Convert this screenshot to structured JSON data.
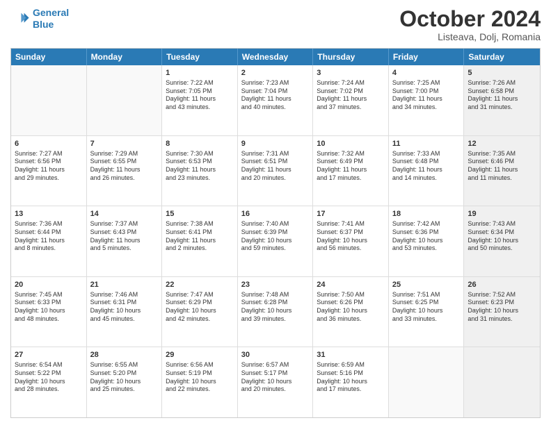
{
  "header": {
    "logo_line1": "General",
    "logo_line2": "Blue",
    "month": "October 2024",
    "location": "Listeava, Dolj, Romania"
  },
  "days_of_week": [
    "Sunday",
    "Monday",
    "Tuesday",
    "Wednesday",
    "Thursday",
    "Friday",
    "Saturday"
  ],
  "rows": [
    [
      {
        "day": "",
        "empty": true
      },
      {
        "day": "",
        "empty": true
      },
      {
        "day": "1",
        "line1": "Sunrise: 7:22 AM",
        "line2": "Sunset: 7:05 PM",
        "line3": "Daylight: 11 hours",
        "line4": "and 43 minutes."
      },
      {
        "day": "2",
        "line1": "Sunrise: 7:23 AM",
        "line2": "Sunset: 7:04 PM",
        "line3": "Daylight: 11 hours",
        "line4": "and 40 minutes."
      },
      {
        "day": "3",
        "line1": "Sunrise: 7:24 AM",
        "line2": "Sunset: 7:02 PM",
        "line3": "Daylight: 11 hours",
        "line4": "and 37 minutes."
      },
      {
        "day": "4",
        "line1": "Sunrise: 7:25 AM",
        "line2": "Sunset: 7:00 PM",
        "line3": "Daylight: 11 hours",
        "line4": "and 34 minutes."
      },
      {
        "day": "5",
        "line1": "Sunrise: 7:26 AM",
        "line2": "Sunset: 6:58 PM",
        "line3": "Daylight: 11 hours",
        "line4": "and 31 minutes.",
        "shaded": true
      }
    ],
    [
      {
        "day": "6",
        "line1": "Sunrise: 7:27 AM",
        "line2": "Sunset: 6:56 PM",
        "line3": "Daylight: 11 hours",
        "line4": "and 29 minutes."
      },
      {
        "day": "7",
        "line1": "Sunrise: 7:29 AM",
        "line2": "Sunset: 6:55 PM",
        "line3": "Daylight: 11 hours",
        "line4": "and 26 minutes."
      },
      {
        "day": "8",
        "line1": "Sunrise: 7:30 AM",
        "line2": "Sunset: 6:53 PM",
        "line3": "Daylight: 11 hours",
        "line4": "and 23 minutes."
      },
      {
        "day": "9",
        "line1": "Sunrise: 7:31 AM",
        "line2": "Sunset: 6:51 PM",
        "line3": "Daylight: 11 hours",
        "line4": "and 20 minutes."
      },
      {
        "day": "10",
        "line1": "Sunrise: 7:32 AM",
        "line2": "Sunset: 6:49 PM",
        "line3": "Daylight: 11 hours",
        "line4": "and 17 minutes."
      },
      {
        "day": "11",
        "line1": "Sunrise: 7:33 AM",
        "line2": "Sunset: 6:48 PM",
        "line3": "Daylight: 11 hours",
        "line4": "and 14 minutes."
      },
      {
        "day": "12",
        "line1": "Sunrise: 7:35 AM",
        "line2": "Sunset: 6:46 PM",
        "line3": "Daylight: 11 hours",
        "line4": "and 11 minutes.",
        "shaded": true
      }
    ],
    [
      {
        "day": "13",
        "line1": "Sunrise: 7:36 AM",
        "line2": "Sunset: 6:44 PM",
        "line3": "Daylight: 11 hours",
        "line4": "and 8 minutes."
      },
      {
        "day": "14",
        "line1": "Sunrise: 7:37 AM",
        "line2": "Sunset: 6:43 PM",
        "line3": "Daylight: 11 hours",
        "line4": "and 5 minutes."
      },
      {
        "day": "15",
        "line1": "Sunrise: 7:38 AM",
        "line2": "Sunset: 6:41 PM",
        "line3": "Daylight: 11 hours",
        "line4": "and 2 minutes."
      },
      {
        "day": "16",
        "line1": "Sunrise: 7:40 AM",
        "line2": "Sunset: 6:39 PM",
        "line3": "Daylight: 10 hours",
        "line4": "and 59 minutes."
      },
      {
        "day": "17",
        "line1": "Sunrise: 7:41 AM",
        "line2": "Sunset: 6:37 PM",
        "line3": "Daylight: 10 hours",
        "line4": "and 56 minutes."
      },
      {
        "day": "18",
        "line1": "Sunrise: 7:42 AM",
        "line2": "Sunset: 6:36 PM",
        "line3": "Daylight: 10 hours",
        "line4": "and 53 minutes."
      },
      {
        "day": "19",
        "line1": "Sunrise: 7:43 AM",
        "line2": "Sunset: 6:34 PM",
        "line3": "Daylight: 10 hours",
        "line4": "and 50 minutes.",
        "shaded": true
      }
    ],
    [
      {
        "day": "20",
        "line1": "Sunrise: 7:45 AM",
        "line2": "Sunset: 6:33 PM",
        "line3": "Daylight: 10 hours",
        "line4": "and 48 minutes."
      },
      {
        "day": "21",
        "line1": "Sunrise: 7:46 AM",
        "line2": "Sunset: 6:31 PM",
        "line3": "Daylight: 10 hours",
        "line4": "and 45 minutes."
      },
      {
        "day": "22",
        "line1": "Sunrise: 7:47 AM",
        "line2": "Sunset: 6:29 PM",
        "line3": "Daylight: 10 hours",
        "line4": "and 42 minutes."
      },
      {
        "day": "23",
        "line1": "Sunrise: 7:48 AM",
        "line2": "Sunset: 6:28 PM",
        "line3": "Daylight: 10 hours",
        "line4": "and 39 minutes."
      },
      {
        "day": "24",
        "line1": "Sunrise: 7:50 AM",
        "line2": "Sunset: 6:26 PM",
        "line3": "Daylight: 10 hours",
        "line4": "and 36 minutes."
      },
      {
        "day": "25",
        "line1": "Sunrise: 7:51 AM",
        "line2": "Sunset: 6:25 PM",
        "line3": "Daylight: 10 hours",
        "line4": "and 33 minutes."
      },
      {
        "day": "26",
        "line1": "Sunrise: 7:52 AM",
        "line2": "Sunset: 6:23 PM",
        "line3": "Daylight: 10 hours",
        "line4": "and 31 minutes.",
        "shaded": true
      }
    ],
    [
      {
        "day": "27",
        "line1": "Sunrise: 6:54 AM",
        "line2": "Sunset: 5:22 PM",
        "line3": "Daylight: 10 hours",
        "line4": "and 28 minutes."
      },
      {
        "day": "28",
        "line1": "Sunrise: 6:55 AM",
        "line2": "Sunset: 5:20 PM",
        "line3": "Daylight: 10 hours",
        "line4": "and 25 minutes."
      },
      {
        "day": "29",
        "line1": "Sunrise: 6:56 AM",
        "line2": "Sunset: 5:19 PM",
        "line3": "Daylight: 10 hours",
        "line4": "and 22 minutes."
      },
      {
        "day": "30",
        "line1": "Sunrise: 6:57 AM",
        "line2": "Sunset: 5:17 PM",
        "line3": "Daylight: 10 hours",
        "line4": "and 20 minutes."
      },
      {
        "day": "31",
        "line1": "Sunrise: 6:59 AM",
        "line2": "Sunset: 5:16 PM",
        "line3": "Daylight: 10 hours",
        "line4": "and 17 minutes."
      },
      {
        "day": "",
        "empty": true
      },
      {
        "day": "",
        "empty": true,
        "shaded": true
      }
    ]
  ]
}
